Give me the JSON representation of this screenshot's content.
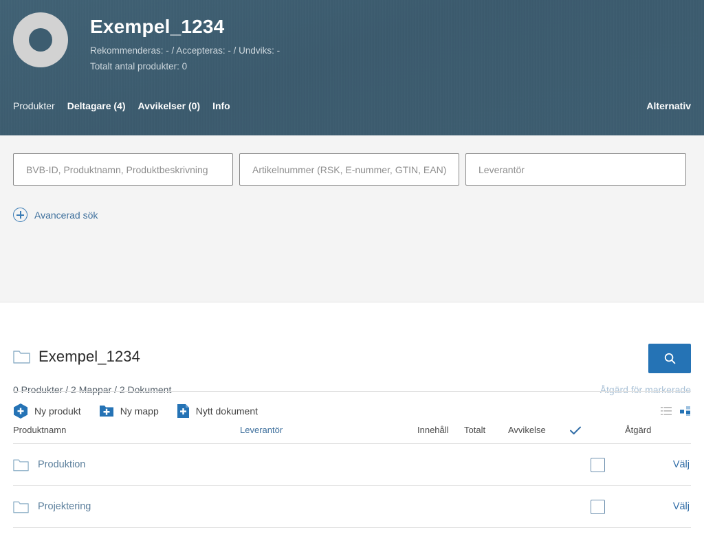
{
  "header": {
    "title": "Exempel_1234",
    "meta_line_1": "Rekommenderas: -  /  Accepteras: -  /  Undviks: -",
    "meta_line_2": "Totalt antal produkter: 0",
    "nav": [
      {
        "label": "Produkter",
        "active": true
      },
      {
        "label": "Deltagare (4)",
        "active": false
      },
      {
        "label": "Avvikelser (0)",
        "active": false
      },
      {
        "label": "Info",
        "active": false
      }
    ],
    "options_label": "Alternativ",
    "background_color": "#3d5d70",
    "avatar_color": "#d2d2d2"
  },
  "search": {
    "field_1_placeholder": "BVB-ID, Produktnamn, Produktbeskrivning",
    "field_1_value": "",
    "field_2_placeholder": "Artikelnummer (RSK, E-nummer, GTIN, EAN)",
    "field_2_value": "",
    "field_3_placeholder": "Leverantör",
    "field_3_value": "",
    "advanced_label": "Avancerad sök",
    "search_button_icon": "search-icon",
    "search_button_color": "#2573b5"
  },
  "create_actions": [
    {
      "label": "Ny produkt",
      "icon": "hexagon-plus-icon"
    },
    {
      "label": "Ny mapp",
      "icon": "folder-plus-icon"
    },
    {
      "label": "Nytt dokument",
      "icon": "document-plus-icon"
    }
  ],
  "view_toggles": [
    {
      "name": "list-view-icon",
      "active": false
    },
    {
      "name": "grid-view-icon",
      "active": true
    }
  ],
  "folder": {
    "icon": "folder-icon",
    "name": "Exempel_1234",
    "counts": "0 Produkter / 2 Mappar / 2 Dokument",
    "bulk_action_label": "Åtgärd för markerade"
  },
  "table": {
    "columns": [
      {
        "label": "Produktnamn",
        "is_link": false
      },
      {
        "label": "Leverantör",
        "is_link": true
      },
      {
        "label": "Innehåll",
        "is_link": false
      },
      {
        "label": "Totalt",
        "is_link": false
      },
      {
        "label": "Avvikelse",
        "is_link": false
      },
      {
        "label": "",
        "icon": "check-icon"
      },
      {
        "label": "Åtgärd",
        "is_link": false
      }
    ],
    "rows": [
      {
        "icon": "folder-icon",
        "name": "Produktion",
        "supplier": "",
        "innehall": "",
        "totalt": "",
        "avvikelse": "",
        "checked": false,
        "action": "Välj"
      },
      {
        "icon": "folder-icon",
        "name": "Projektering",
        "supplier": "",
        "innehall": "",
        "totalt": "",
        "avvikelse": "",
        "checked": false,
        "action": "Välj"
      }
    ]
  },
  "colors": {
    "accent_blue": "#2573b5",
    "link_blue": "#3d6f9c",
    "header_bg": "#3d5d70",
    "panel_bg": "#f4f4f4"
  }
}
